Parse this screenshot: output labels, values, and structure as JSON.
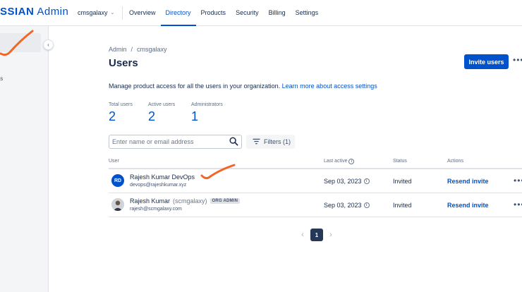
{
  "header": {
    "logo_brand": "SSIAN",
    "logo_product": "Admin",
    "org_name": "cmsgalaxy",
    "tabs": [
      {
        "label": "Overview"
      },
      {
        "label": "Directory"
      },
      {
        "label": "Products"
      },
      {
        "label": "Security"
      },
      {
        "label": "Billing"
      },
      {
        "label": "Settings"
      }
    ],
    "active_tab": "Directory"
  },
  "sidebar": {
    "partial_item_label": "ts"
  },
  "breadcrumb": {
    "root": "Admin",
    "separator": "/",
    "current": "cmsgalaxy"
  },
  "page": {
    "title": "Users",
    "invite_label": "Invite users",
    "description": "Manage product access for all the users in your organization.",
    "learn_more_link": "Learn more about access settings"
  },
  "stats": [
    {
      "label": "Total users",
      "value": "2"
    },
    {
      "label": "Active users",
      "value": "2"
    },
    {
      "label": "Administrators",
      "value": "1"
    }
  ],
  "search": {
    "placeholder": "Enter name or email address"
  },
  "filters": {
    "label": "Filters (1)"
  },
  "table": {
    "columns": {
      "user": "User",
      "last_active": "Last active",
      "status": "Status",
      "actions": "Actions"
    },
    "rows": [
      {
        "initials": "RD",
        "name": "Rajesh Kumar DevOps",
        "org_suffix": "",
        "badge": "",
        "email": "devops@rajeshkumar.xyz",
        "last_active": "Sep 03, 2023",
        "status": "Invited",
        "action": "Resend invite"
      },
      {
        "initials": "",
        "name": "Rajesh Kumar",
        "org_suffix": "(scmgalaxy)",
        "badge": "ORG ADMIN",
        "email": "rajesh@scmgalaxy.com",
        "last_active": "Sep 03, 2023",
        "status": "Invited",
        "action": "Resend invite"
      }
    ]
  },
  "pagination": {
    "current_page": "1"
  },
  "colors": {
    "brand": "#0052cc",
    "annotation": "#f26522",
    "text": "#172b4d"
  }
}
